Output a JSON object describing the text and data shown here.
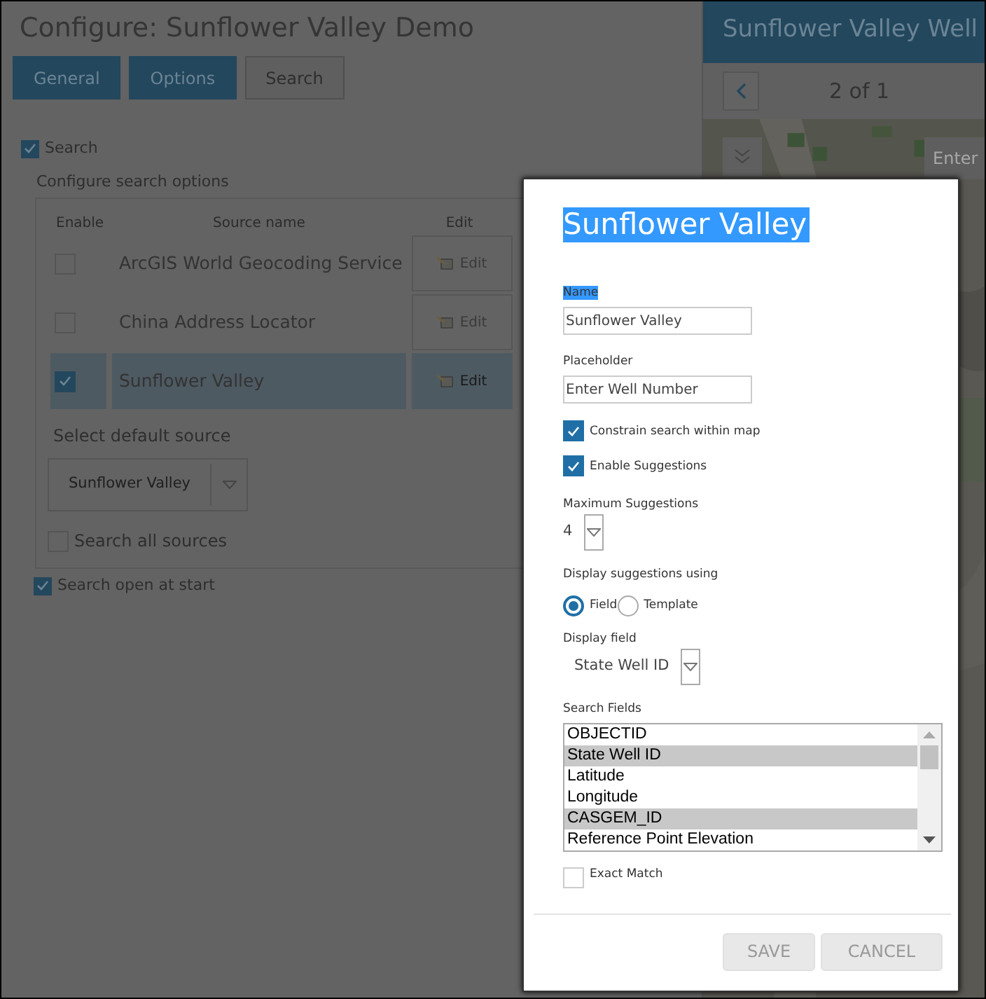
{
  "page": {
    "title": "Configure: Sunflower Valley Demo",
    "tabs": [
      {
        "label": "General",
        "selected": false
      },
      {
        "label": "Options",
        "selected": false
      },
      {
        "label": "Search",
        "selected": true
      }
    ],
    "search_toggle": {
      "label": "Search",
      "checked": true
    },
    "section_label": "Configure search options",
    "table": {
      "columns": [
        "Enable",
        "Source name",
        "Edit"
      ],
      "rows": [
        {
          "enabled": false,
          "name": "ArcGIS World Geocoding Service",
          "edit": "Edit",
          "selected": false
        },
        {
          "enabled": false,
          "name": "China Address Locator",
          "edit": "Edit",
          "selected": false
        },
        {
          "enabled": true,
          "name": "Sunflower Valley",
          "edit": "Edit",
          "selected": true
        }
      ]
    },
    "default_source": {
      "label": "Select default source",
      "value": "Sunflower Valley"
    },
    "search_all": {
      "label": "Search all sources",
      "checked": false
    },
    "open_at_start": {
      "label": "Search open at start",
      "checked": true
    }
  },
  "preview": {
    "title": "Sunflower Valley Well",
    "pager": "2 of 1",
    "search_placeholder": "Enter"
  },
  "dialog": {
    "title": "Sunflower Valley",
    "title_highlighted": true,
    "name_field": {
      "label": "Name",
      "label_highlighted": true,
      "value": "Sunflower Valley"
    },
    "placeholder_field": {
      "label": "Placeholder",
      "value": "Enter Well Number"
    },
    "checkboxes": [
      {
        "label": "Constrain search within map",
        "checked": true
      },
      {
        "label": "Enable Suggestions",
        "checked": true
      }
    ],
    "max_suggestions": {
      "label": "Maximum Suggestions",
      "value": "4"
    },
    "display_using": {
      "label": "Display suggestions using",
      "options": [
        {
          "label": "Field",
          "selected": true
        },
        {
          "label": "Template",
          "selected": false
        }
      ]
    },
    "display_field": {
      "label": "Display field",
      "value": "State Well ID"
    },
    "search_fields": {
      "label": "Search Fields",
      "items": [
        {
          "label": "OBJECTID",
          "selected": false
        },
        {
          "label": "State Well ID",
          "selected": true
        },
        {
          "label": "Latitude",
          "selected": false
        },
        {
          "label": "Longitude",
          "selected": false
        },
        {
          "label": "CASGEM_ID",
          "selected": true
        },
        {
          "label": "Reference Point Elevation",
          "selected": false
        }
      ]
    },
    "exact_match": {
      "label": "Exact Match",
      "checked": false
    },
    "buttons": [
      {
        "label": "SAVE"
      },
      {
        "label": "CANCEL"
      }
    ]
  }
}
